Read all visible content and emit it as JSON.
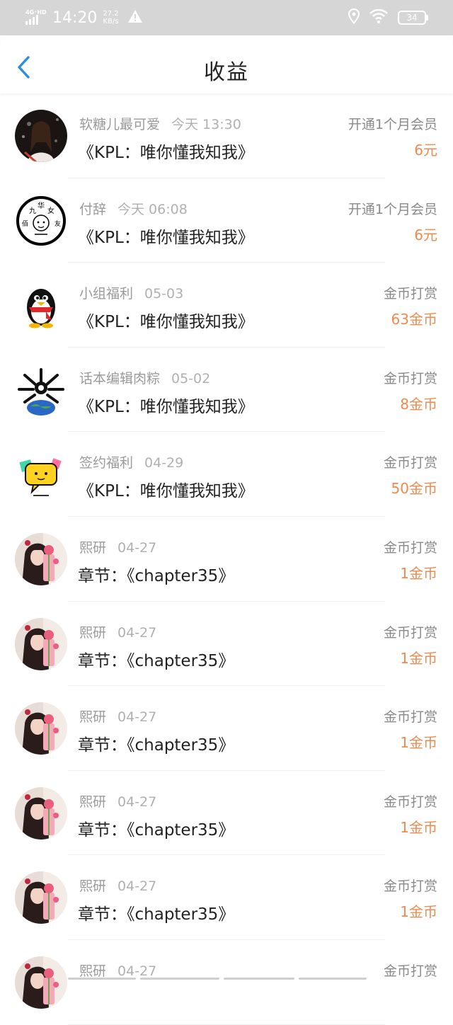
{
  "status_bar": {
    "network": "4G⁺HD",
    "time": "14:20",
    "speed_value": "27.2",
    "speed_unit": "KB/s",
    "battery": "34"
  },
  "header": {
    "title": "收益"
  },
  "colors": {
    "amount": "#ee8a4e",
    "back": "#2a8de0"
  },
  "rows": [
    {
      "name": "软糖儿最可爱",
      "time": "今天 13:30",
      "subject": "《KPL：唯你懂我知我》",
      "kind": "开通1个月会员",
      "amount": "6元",
      "avatar": "girl-photo-avatar"
    },
    {
      "name": "付辞",
      "time": "今天 06:08",
      "subject": "《KPL：唯你懂我知我》",
      "kind": "开通1个月会员",
      "amount": "6元",
      "avatar": "drawn-stamp-avatar"
    },
    {
      "name": "小组福利",
      "time": "05-03",
      "subject": "《KPL：唯你懂我知我》",
      "kind": "金币打赏",
      "amount": "63金币",
      "avatar": "penguin-avatar"
    },
    {
      "name": "话本编辑肉粽",
      "time": "05-02",
      "subject": "《KPL：唯你懂我知我》",
      "kind": "金币打赏",
      "amount": "8金币",
      "avatar": "globe-avatar"
    },
    {
      "name": "签约福利",
      "time": "04-29",
      "subject": "《KPL：唯你懂我知我》",
      "kind": "金币打赏",
      "amount": "50金币",
      "avatar": "chat-bubble-avatar"
    },
    {
      "name": "熙研",
      "time": "04-27",
      "subject": "章节：《chapter35》",
      "kind": "金币打赏",
      "amount": "1金币",
      "avatar": "girl-flowers-avatar"
    },
    {
      "name": "熙研",
      "time": "04-27",
      "subject": "章节：《chapter35》",
      "kind": "金币打赏",
      "amount": "1金币",
      "avatar": "girl-flowers-avatar"
    },
    {
      "name": "熙研",
      "time": "04-27",
      "subject": "章节：《chapter35》",
      "kind": "金币打赏",
      "amount": "1金币",
      "avatar": "girl-flowers-avatar"
    },
    {
      "name": "熙研",
      "time": "04-27",
      "subject": "章节：《chapter35》",
      "kind": "金币打赏",
      "amount": "1金币",
      "avatar": "girl-flowers-avatar"
    },
    {
      "name": "熙研",
      "time": "04-27",
      "subject": "章节：《chapter35》",
      "kind": "金币打赏",
      "amount": "1金币",
      "avatar": "girl-flowers-avatar"
    },
    {
      "name": "熙研",
      "time": "04-27",
      "subject": "",
      "kind": "金币打赏",
      "amount": "",
      "avatar": "girl-flowers-avatar"
    }
  ]
}
